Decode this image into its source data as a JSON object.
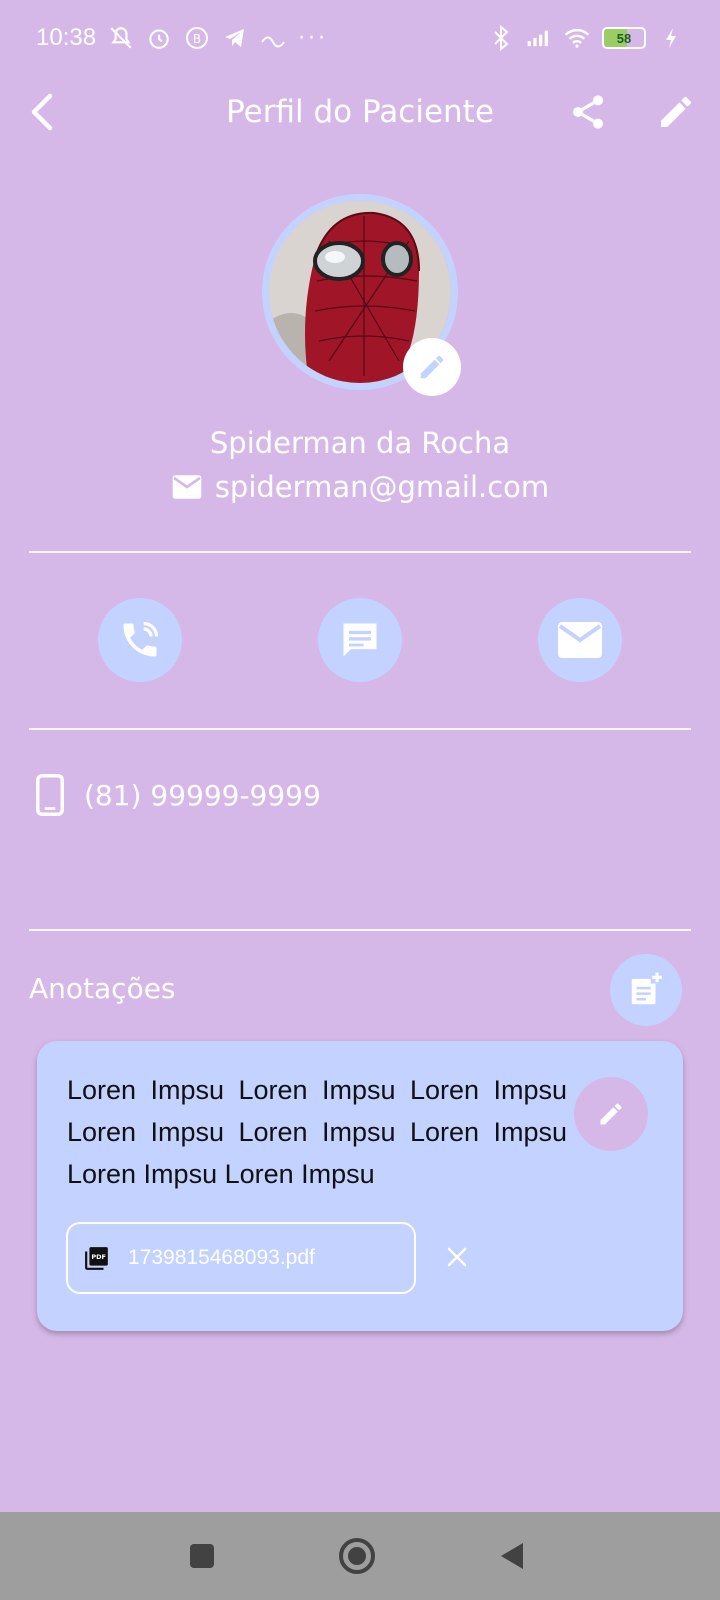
{
  "status_bar": {
    "time": "10:38",
    "battery": "58",
    "battery_fraction": 0.58,
    "more": "···",
    "icons": [
      "mute-icon",
      "alarm-icon",
      "b-app-icon",
      "telegram-icon",
      "app-icon",
      "bluetooth-icon",
      "signal-icon",
      "wifi-icon",
      "battery-icon",
      "charging-icon"
    ]
  },
  "app_bar": {
    "title": "Perfil do Paciente",
    "back_icon": "chevron-left-icon",
    "share_icon": "share-icon",
    "edit_icon": "pencil-icon"
  },
  "profile": {
    "name": "Spiderman da Rocha",
    "email": "spiderman@gmail.com",
    "phone": "(81) 99999-9999"
  },
  "actions": {
    "call_icon": "phone-call-icon",
    "message_icon": "chat-icon",
    "email_icon": "mail-icon"
  },
  "notes": {
    "title": "Anotações",
    "items": [
      {
        "text": "Loren Impsu Loren Impsu Loren Impsu Loren Impsu Loren Impsu Loren Impsu Loren Impsu Loren Impsu",
        "attachment": "1739815468093.pdf"
      }
    ]
  },
  "colors": {
    "background": "#d6b8e8",
    "accent": "#c4d2ff",
    "nav_bar": "#9e9e9e"
  }
}
